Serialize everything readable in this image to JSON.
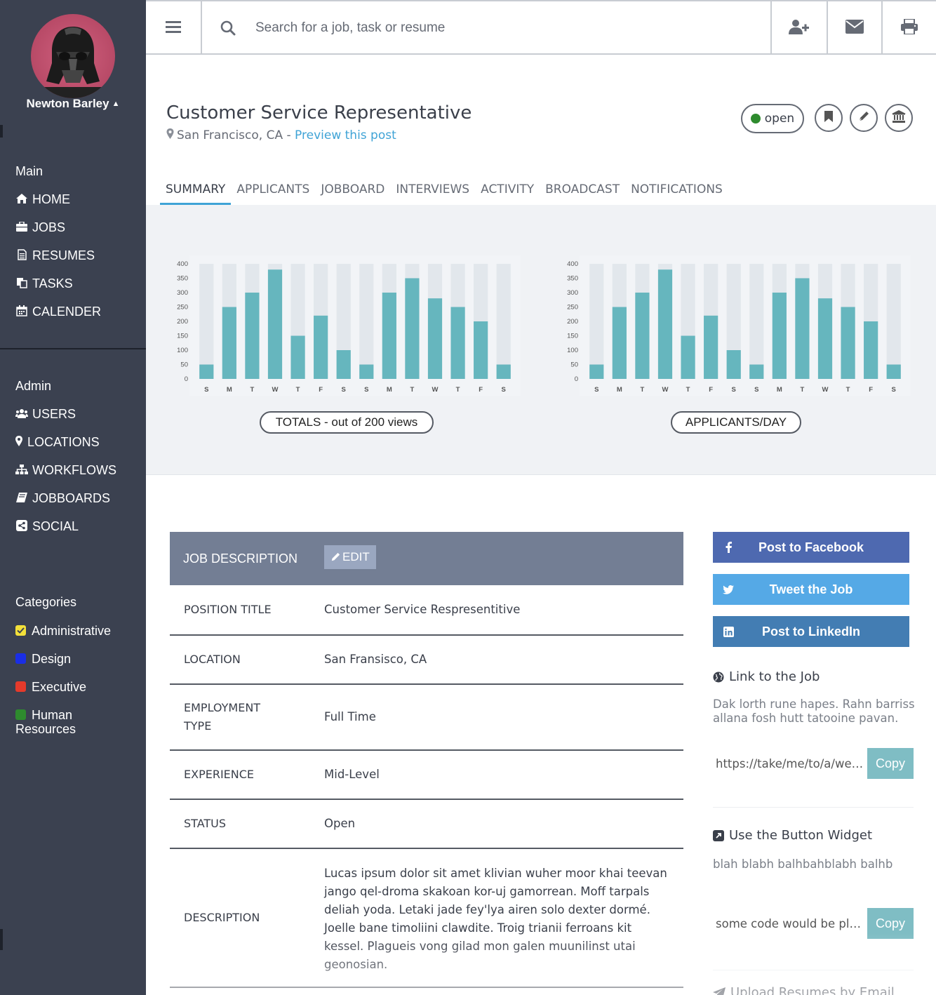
{
  "user": {
    "name": "Newton Barley"
  },
  "search": {
    "placeholder": "Search for a job, task or resume"
  },
  "topbar_icons": [
    "menu-icon",
    "search-icon",
    "add-user-icon",
    "mail-icon",
    "print-icon"
  ],
  "sidebar": {
    "main_label": "Main",
    "main_items": [
      {
        "label": "HOME",
        "icon": "home-icon"
      },
      {
        "label": "JOBS",
        "icon": "briefcase-icon"
      },
      {
        "label": "RESUMES",
        "icon": "document-icon"
      },
      {
        "label": "TASKS",
        "icon": "copy-icon"
      },
      {
        "label": "CALENDER",
        "icon": "calendar-icon"
      }
    ],
    "admin_label": "Admin",
    "admin_items": [
      {
        "label": "USERS",
        "icon": "users-icon"
      },
      {
        "label": "LOCATIONS",
        "icon": "map-marker-icon"
      },
      {
        "label": "WORKFLOWS",
        "icon": "sitemap-icon"
      },
      {
        "label": "JOBBOARDS",
        "icon": "book-icon"
      },
      {
        "label": "SOCIAL",
        "icon": "share-icon"
      }
    ],
    "categories_label": "Categories",
    "categories": [
      {
        "label": "Administrative",
        "color": "#f3e03a",
        "checked": true
      },
      {
        "label": "Design",
        "color": "#1a2ee6"
      },
      {
        "label": "Executive",
        "color": "#e53a2b"
      },
      {
        "label": "Human Resources",
        "label_line1": "Human",
        "label_line2": "Resources",
        "color": "#2e8b2e"
      }
    ]
  },
  "job": {
    "title": "Customer Service Representative",
    "location": "San Francisco, CA -",
    "preview_link": "Preview this post",
    "status": "open",
    "status_color": "#2e8b2e"
  },
  "tabs": [
    "SUMMARY",
    "APPLICANTS",
    "JOBBOARD",
    "INTERVIEWS",
    "ACTIVITY",
    "BROADCAST",
    "NOTIFICATIONS"
  ],
  "chart_data": [
    {
      "type": "bar",
      "categories": [
        "S",
        "M",
        "T",
        "W",
        "T",
        "F",
        "S",
        "S",
        "M",
        "T",
        "W",
        "T",
        "F",
        "S"
      ],
      "values": [
        50,
        250,
        300,
        380,
        150,
        220,
        100,
        50,
        300,
        350,
        280,
        250,
        200,
        50
      ],
      "ylim": [
        0,
        400
      ],
      "yticks": [
        0,
        50,
        100,
        150,
        200,
        250,
        300,
        350,
        400
      ],
      "background_bar_max": 400,
      "bar_color": "#66b6be",
      "track_color": "#e2e7ec",
      "title": "TOTALS - out of 200 views"
    },
    {
      "type": "bar",
      "categories": [
        "S",
        "M",
        "T",
        "W",
        "T",
        "F",
        "S",
        "S",
        "M",
        "T",
        "W",
        "T",
        "F",
        "S"
      ],
      "values": [
        50,
        250,
        300,
        380,
        150,
        220,
        100,
        50,
        300,
        350,
        280,
        250,
        200,
        50
      ],
      "ylim": [
        0,
        400
      ],
      "yticks": [
        0,
        50,
        100,
        150,
        200,
        250,
        300,
        350,
        400
      ],
      "background_bar_max": 400,
      "bar_color": "#66b6be",
      "track_color": "#e2e7ec",
      "title": "APPLICANTS/DAY"
    }
  ],
  "job_description": {
    "header": "JOB DESCRIPTION",
    "edit_label": "EDIT",
    "rows": [
      {
        "key": "POSITION TITLE",
        "value": "Customer Service Respresentitive"
      },
      {
        "key": "LOCATION",
        "value": "San Fransisco, CA"
      },
      {
        "key": "EMPLOYMENT TYPE",
        "value": "Full Time"
      },
      {
        "key": "EXPERIENCE",
        "value": "Mid-Level"
      },
      {
        "key": "STATUS",
        "value": "Open"
      },
      {
        "key": "DESCRIPTION",
        "value": "Lucas ipsum dolor sit amet klivian wuher moor khai teevan jango qel-droma skakoan kor-uj gamorrean. Moff tarpals deliah yoda. Letaki jade fey'lya airen solo dexter dormé. Joelle bane timoliini clawdite. Troig trianii ferroans kit kessel. Plagueis vong gilad mon galen muunilinst utai geonosian."
      }
    ]
  },
  "share": {
    "facebook": {
      "label": "Post to Facebook",
      "color": "#4e69b0"
    },
    "twitter": {
      "label": "Tweet the Job",
      "color": "#55a9e6"
    },
    "linkedin": {
      "label": "Post to LinkedIn",
      "color": "#437db3"
    }
  },
  "link_section": {
    "title": "Link to the Job",
    "text": "Dak lorth rune hapes. Rahn barriss allana fosh hutt tatooine pavan.",
    "url_value": "https://take/me/to/a/website",
    "copy_label": "Copy"
  },
  "widget_section": {
    "title": "Use the Button Widget",
    "text": "blah blabh balhbahblabh balhb",
    "code_value": "some code would be placed here",
    "copy_label": "Copy"
  },
  "upload_section": {
    "title": "Upload Resumes by Email"
  }
}
